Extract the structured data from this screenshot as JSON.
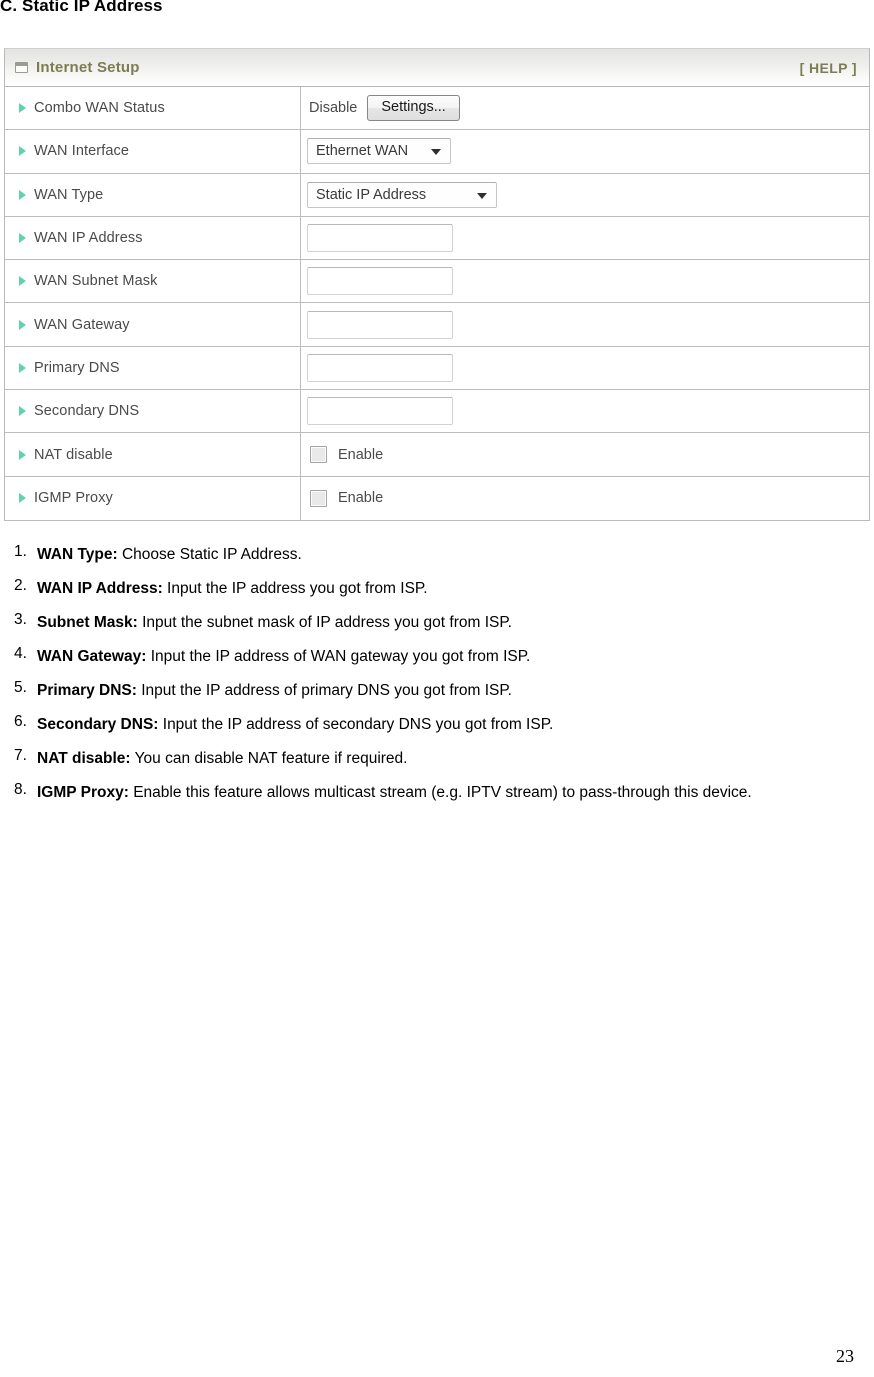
{
  "heading": "C. Static IP Address",
  "panel": {
    "title": "Internet Setup",
    "window_icon": "window-icon",
    "help_label": "[ HELP ]",
    "rows": [
      {
        "label": "Combo WAN Status",
        "type": "text-button",
        "value": "Disable",
        "button_label": "Settings..."
      },
      {
        "label": "WAN Interface",
        "type": "select",
        "width": "narrow",
        "value": "Ethernet WAN"
      },
      {
        "label": "WAN Type",
        "type": "select",
        "width": "wide",
        "value": "Static IP Address"
      },
      {
        "label": "WAN IP Address",
        "type": "input",
        "value": "",
        "placeholder": ""
      },
      {
        "label": "WAN Subnet Mask",
        "type": "input",
        "value": "",
        "placeholder": ""
      },
      {
        "label": "WAN Gateway",
        "type": "input",
        "value": "",
        "placeholder": ""
      },
      {
        "label": "Primary DNS",
        "type": "input",
        "value": "",
        "placeholder": ""
      },
      {
        "label": "Secondary DNS",
        "type": "input",
        "value": "",
        "placeholder": ""
      },
      {
        "label": "NAT disable",
        "type": "checkbox",
        "checkbox_label": "Enable",
        "checked": false
      },
      {
        "label": "IGMP Proxy",
        "type": "checkbox",
        "checkbox_label": "Enable",
        "checked": false
      }
    ]
  },
  "notes": [
    {
      "num": "1.",
      "term": "WAN Type:",
      "text": " Choose Static IP Address.",
      "justified": false
    },
    {
      "num": "2.",
      "term": "WAN IP Address:",
      "text": " Input the IP address you got from ISP.",
      "justified": false
    },
    {
      "num": "3.",
      "term": "Subnet Mask:",
      "text": " Input the subnet mask of IP address you got from ISP.",
      "justified": false
    },
    {
      "num": "4.",
      "term": "WAN Gateway:",
      "text": " Input the IP address of WAN gateway you got from ISP.",
      "justified": false
    },
    {
      "num": "5.",
      "term": "Primary DNS:",
      "text": " Input the IP address of primary DNS you got from ISP.",
      "justified": false
    },
    {
      "num": "6.",
      "term": "Secondary DNS:",
      "text": " Input the IP address of secondary DNS you got from ISP.",
      "justified": false
    },
    {
      "num": "7.",
      "term": "NAT disable:",
      "text": " You can disable NAT feature if required.",
      "justified": false
    },
    {
      "num": "8.",
      "term": "IGMP Proxy:",
      "text": " Enable this feature allows multicast stream (e.g. IPTV stream) to pass-through this device.",
      "justified": true
    }
  ],
  "page_number": "23",
  "colors": {
    "panel_title": "#7c7d52",
    "bullet": "#5fd3ab",
    "label_text": "#4a4a4a",
    "border": "#bdbdbd"
  }
}
